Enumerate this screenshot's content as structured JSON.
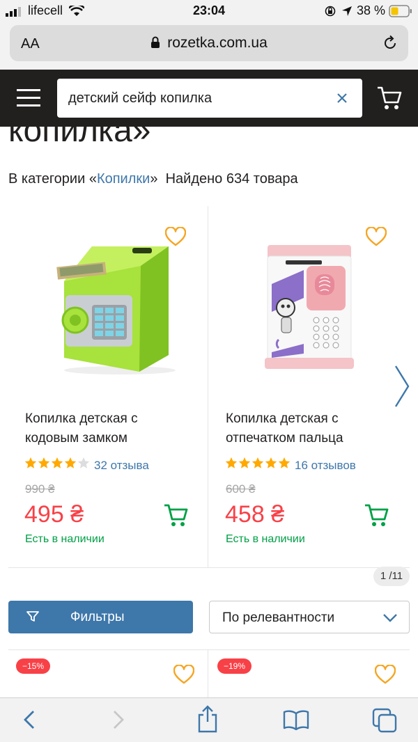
{
  "status_bar": {
    "carrier": "lifecell",
    "time": "23:04",
    "battery": "38 %"
  },
  "browser": {
    "text_size_label": "AA",
    "url": "rozetka.com.ua"
  },
  "header": {
    "search_value": "детский сейф копилка"
  },
  "page": {
    "heading_fragment": "копилка»",
    "category_prefix": "В категории «",
    "category_link": "Копилки",
    "category_suffix": "»",
    "found_count": "Найдено 634 товара"
  },
  "products": [
    {
      "title_line1": "Копилка детская с",
      "title_line2": "кодовым замком",
      "rating": 4.5,
      "reviews": "32 отзыва",
      "old_price": "990 ₴",
      "price": "495 ₴",
      "stock": "Есть в наличии"
    },
    {
      "title_line1": "Копилка детская с",
      "title_line2": "отпечатком пальца",
      "rating": 5,
      "reviews": "16 отзывов",
      "old_price": "600 ₴",
      "price": "458 ₴",
      "stock": "Есть в наличии"
    }
  ],
  "pager": "1 /11",
  "controls": {
    "filters_label": "Фильтры",
    "sort_label": "По релевантности"
  },
  "next_row_badges": [
    "−15%",
    "−19%"
  ],
  "colors": {
    "header_bg": "#221f1f",
    "accent_blue": "#3e77aa",
    "price_red": "#f84147",
    "stock_green": "#00a046",
    "heart_gold": "#f5a623",
    "star_gold": "#ffa900"
  },
  "icons": {
    "menu": "hamburger-icon",
    "cart": "cart-icon",
    "clear": "close-icon",
    "wishlist": "heart-icon",
    "next": "chevron-right-icon",
    "filter": "filter-icon",
    "sort": "chevron-down-icon",
    "back": "back-icon",
    "forward": "forward-icon",
    "share": "share-icon",
    "bookmarks": "book-icon",
    "tabs": "tabs-icon"
  }
}
